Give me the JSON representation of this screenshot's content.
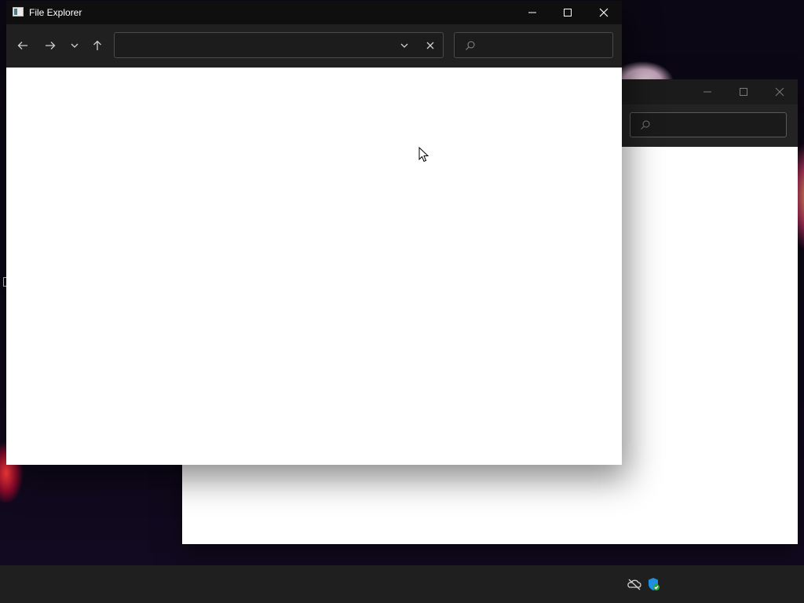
{
  "front_window": {
    "title": "File Explorer",
    "controls": {
      "minimize": "minimize",
      "maximize": "maximize",
      "close": "close"
    },
    "nav": [
      "back",
      "forward",
      "recent",
      "up"
    ],
    "address": {
      "value": "",
      "placeholder": ""
    },
    "search": {
      "value": "",
      "placeholder": ""
    }
  },
  "back_window": {
    "title": "",
    "controls": {
      "minimize": "minimize",
      "maximize": "maximize",
      "close": "close"
    },
    "search": {
      "placeholder": ""
    }
  },
  "taskbar": {
    "tray": [
      "onedrive-offline-icon",
      "windows-security-icon"
    ]
  },
  "colors": {
    "titlebar": "#0f0f0f",
    "toolbar": "#202020",
    "taskbar": "#1f1f1f",
    "content": "#ffffff"
  }
}
